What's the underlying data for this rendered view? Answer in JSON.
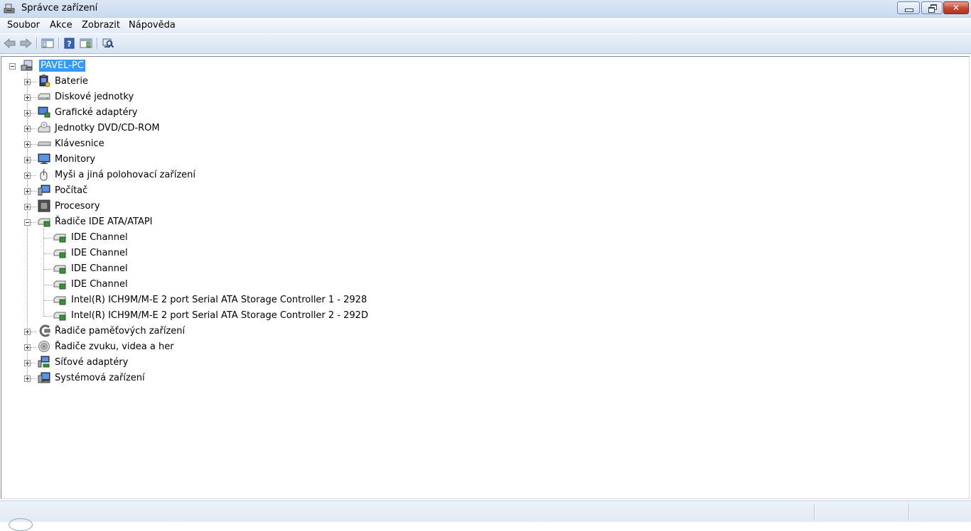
{
  "window": {
    "title": "Správce zařízení",
    "close_glyph": "✕"
  },
  "menu": {
    "items": [
      "Soubor",
      "Akce",
      "Zobrazit",
      "Nápověda"
    ]
  },
  "toolbar": {
    "icons": [
      "back-arrow-icon",
      "forward-arrow-icon",
      "show-hide-console-tree-icon",
      "help-icon",
      "properties-icon",
      "scan-hardware-icon"
    ]
  },
  "tree": {
    "root": "PAVEL-PC",
    "categories": [
      "Baterie",
      "Diskové jednotky",
      "Grafické adaptéry",
      "Jednotky DVD/CD-ROM",
      "Klávesnice",
      "Monitory",
      "Myši a jiná polohovací zařízení",
      "Počítač",
      "Procesory",
      "Řadiče IDE ATA/ATAPI",
      "Řadiče paměťových zařízení",
      "Řadiče zvuku, videa a her",
      "Síťové adaptéry",
      "Systémová zařízení"
    ],
    "ide_children": [
      "IDE Channel",
      "IDE Channel",
      "IDE Channel",
      "IDE Channel",
      "Intel(R) ICH9M/M-E 2 port Serial ATA Storage Controller 1 - 2928",
      "Intel(R) ICH9M/M-E 2 port Serial ATA Storage Controller 2 - 292D"
    ]
  },
  "colors": {
    "selection": "#3399ff",
    "title_gradient_top": "#dbe7f5",
    "close_button": "#c7462f"
  }
}
